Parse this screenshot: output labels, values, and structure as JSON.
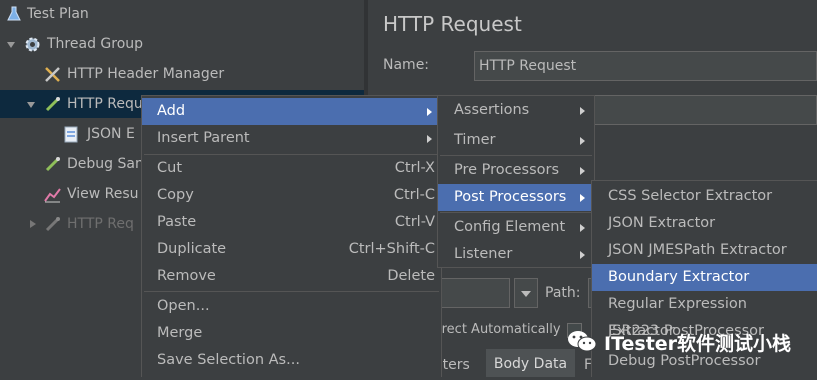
{
  "tree": {
    "test_plan": "Test Plan",
    "thread_group": "Thread Group",
    "header_manager": "HTTP Header Manager",
    "http_request": "HTTP Requ",
    "json_extractor": "JSON E",
    "debug_sampler": "Debug Sam",
    "view_results": "View Resu",
    "http_request2": "HTTP Req"
  },
  "panel": {
    "title": "HTTP Request",
    "name_label": "Name:",
    "name_value": "HTTP Request",
    "path_label": "Path:",
    "redirect_text": "irect Automatically",
    "tab_parameters": "eters",
    "tab_body": "Body Data",
    "tab_files": "F"
  },
  "context_menu": {
    "add": "Add",
    "insert_parent": "Insert Parent",
    "cut": "Cut",
    "cut_sc": "Ctrl-X",
    "copy": "Copy",
    "copy_sc": "Ctrl-C",
    "paste": "Paste",
    "paste_sc": "Ctrl-V",
    "duplicate": "Duplicate",
    "duplicate_sc": "Ctrl+Shift-C",
    "remove": "Remove",
    "remove_sc": "Delete",
    "open": "Open...",
    "merge": "Merge",
    "save_selection": "Save Selection As..."
  },
  "add_menu": {
    "assertions": "Assertions",
    "timer": "Timer",
    "pre_processors": "Pre Processors",
    "post_processors": "Post Processors",
    "config_element": "Config Element",
    "listener": "Listener"
  },
  "post_menu": {
    "css": "CSS Selector Extractor",
    "json": "JSON Extractor",
    "jmespath": "JSON JMESPath Extractor",
    "boundary": "Boundary Extractor",
    "regex": "Regular Expression Extractor",
    "jsr223": "JSR223 PostProcessor",
    "debug": "Debug PostProcessor"
  },
  "watermark": "ITester软件测试小栈",
  "colors": {
    "highlight": "#4b6eaf",
    "background": "#3c3f41"
  }
}
